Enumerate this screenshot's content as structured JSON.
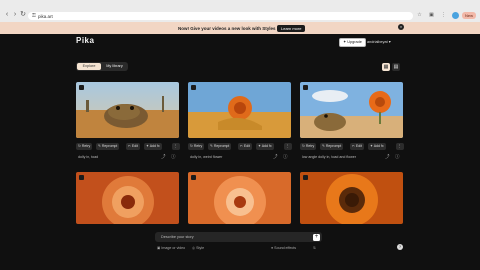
{
  "browser": {
    "url": "pika.art",
    "new_label": "New"
  },
  "banner": {
    "message": "Now! Give your videos a new look with Styles",
    "button": "Learn more"
  },
  "header": {
    "logo": "Pika",
    "upgrade": "Upgrade",
    "username": "andrialbeyat"
  },
  "tabs": [
    "Explore",
    "My library"
  ],
  "card_actions": [
    "Retry",
    "Reprompt",
    "Edit",
    "Add fx"
  ],
  "cards": [
    {
      "caption": "dolly in, toad"
    },
    {
      "caption": "dolly in, weird flower"
    },
    {
      "caption": "low angle dolly in, toad and flower"
    },
    {
      "caption": ""
    },
    {
      "caption": ""
    },
    {
      "caption": ""
    }
  ],
  "prompt": {
    "placeholder": "Describe your story",
    "image_label": "Image or video",
    "style_label": "Style",
    "effects_label": "Sound effects"
  },
  "colors": {
    "banner_bg": "#f2d6c4",
    "accent_tab": "#f6e5d3",
    "page_bg": "#101010"
  }
}
